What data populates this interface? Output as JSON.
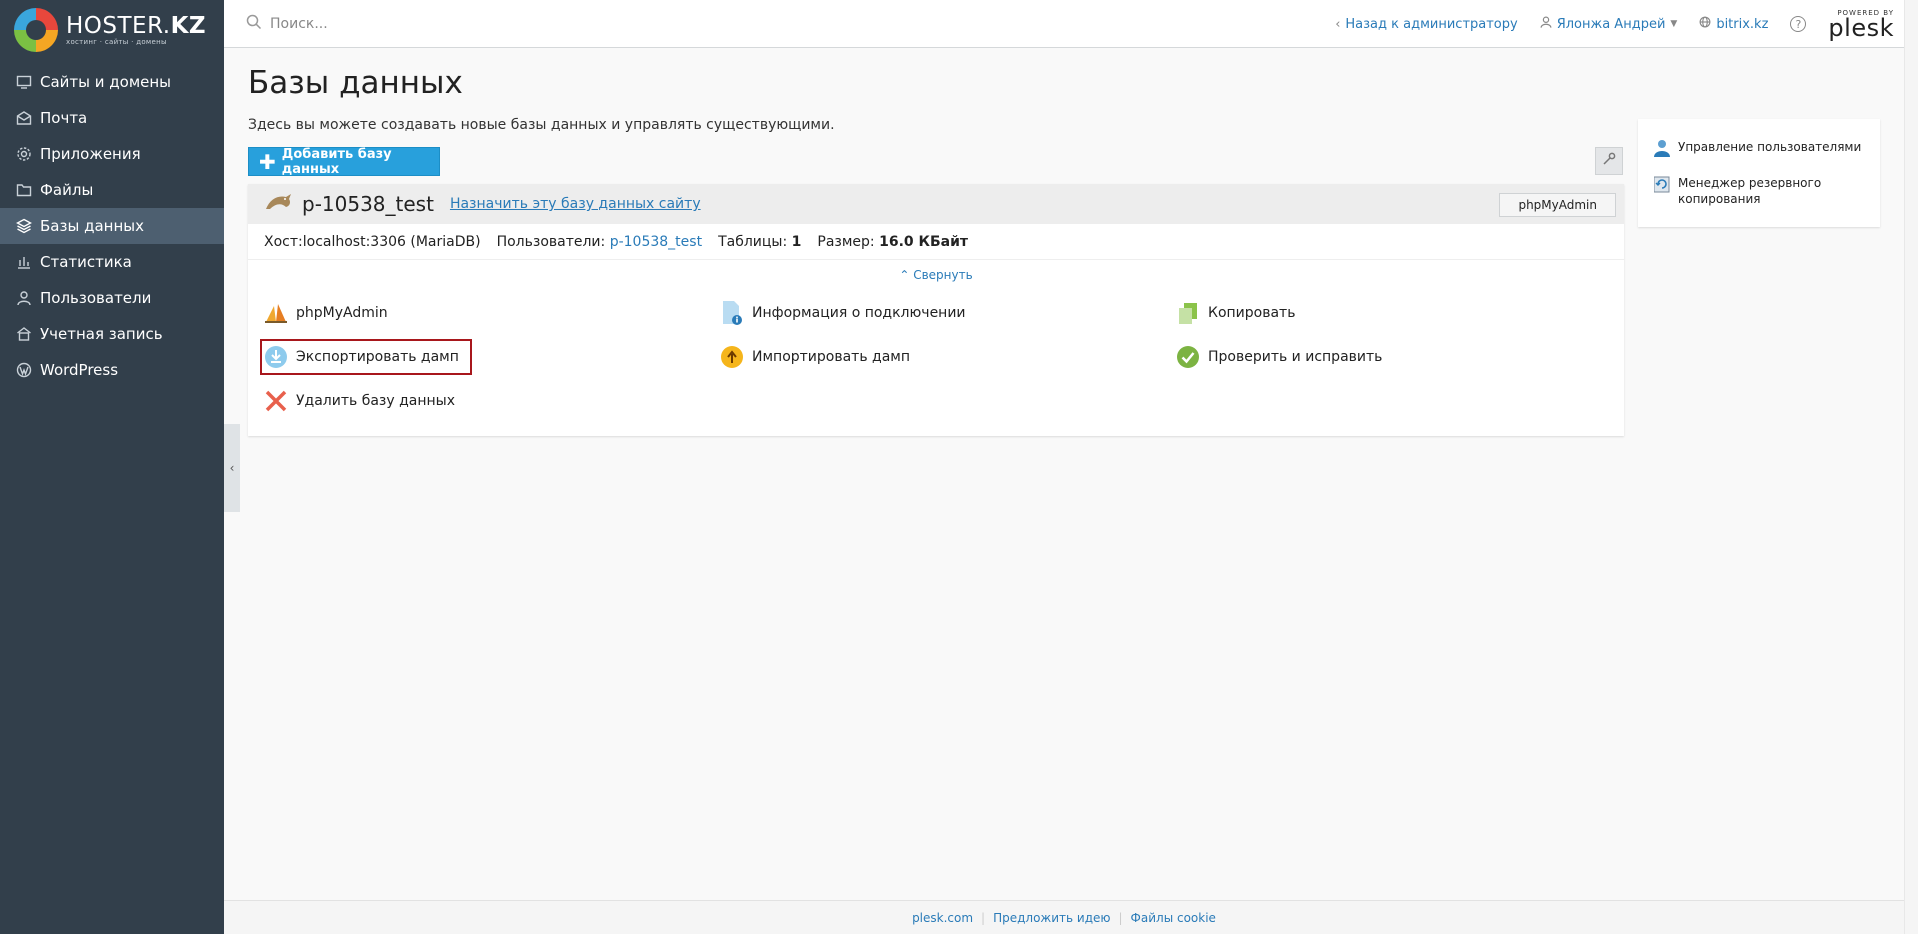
{
  "brand": {
    "name": "HOSTER.",
    "tld": "KZ",
    "tagline": "хостинг · сайты · домены"
  },
  "sidebar": {
    "items": [
      {
        "label": "Сайты и домены",
        "icon": "monitor-icon"
      },
      {
        "label": "Почта",
        "icon": "mail-icon"
      },
      {
        "label": "Приложения",
        "icon": "gear-icon"
      },
      {
        "label": "Файлы",
        "icon": "folder-icon"
      },
      {
        "label": "Базы данных",
        "icon": "database-icon",
        "active": true
      },
      {
        "label": "Статистика",
        "icon": "chart-icon"
      },
      {
        "label": "Пользователи",
        "icon": "user-icon"
      },
      {
        "label": "Учетная запись",
        "icon": "account-icon"
      },
      {
        "label": "WordPress",
        "icon": "wordpress-icon"
      }
    ],
    "collapse_glyph": "‹"
  },
  "header": {
    "search_placeholder": "Поиск...",
    "back_link": "Назад к администратору",
    "user": "Ялонжа Андрей",
    "domain": "bitrix.kz",
    "help": "?",
    "powered_by": "POWERED BY",
    "plesk": "plesk"
  },
  "main": {
    "title": "Базы данных",
    "description": "Здесь вы можете создавать новые базы данных и управлять существующими.",
    "add_button": "Добавить базу данных"
  },
  "database": {
    "name": "p-10538_test",
    "assign_link": "Назначить эту базу данных сайту",
    "phpmyadmin_button": "phpMyAdmin",
    "host_label": "Хост:",
    "host_value": "localhost:3306 (MariaDB)",
    "users_label": "Пользователи:",
    "users_value": "p-10538_test",
    "tables_label": "Таблицы:",
    "tables_value": "1",
    "size_label": "Размер:",
    "size_value": "16.0 КБайт",
    "collapse": "Свернуть",
    "actions": {
      "phpmyadmin": "phpMyAdmin",
      "connection_info": "Информация о подключении",
      "copy": "Копировать",
      "export_dump": "Экспортировать дамп",
      "import_dump": "Импортировать дамп",
      "check_repair": "Проверить и исправить",
      "delete": "Удалить базу данных"
    }
  },
  "side_panel": {
    "user_management": "Управление пользователями",
    "backup_manager": "Менеджер резервного копирования"
  },
  "footer": {
    "links": [
      "plesk.com",
      "Предложить идею",
      "Файлы cookie"
    ]
  },
  "colors": {
    "sidebar_bg": "#323f4b",
    "sidebar_active": "#4d5f70",
    "accent": "#28a0dc",
    "link": "#2a7bb8",
    "highlight_border": "#a8171c"
  }
}
